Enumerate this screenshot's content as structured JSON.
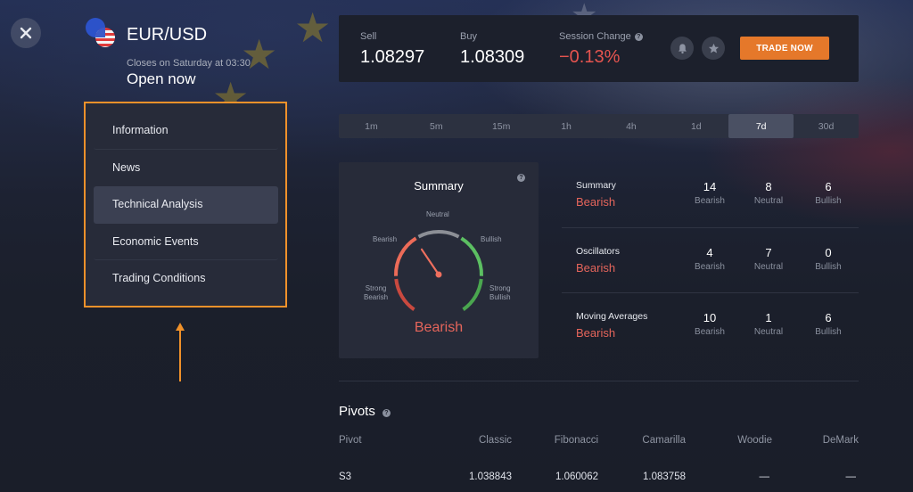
{
  "asset": {
    "name": "EUR/USD",
    "closes_text": "Closes on Saturday at 03:30",
    "status": "Open now"
  },
  "sidebar": {
    "items": [
      {
        "label": "Information",
        "active": false
      },
      {
        "label": "News",
        "active": false
      },
      {
        "label": "Technical Analysis",
        "active": true
      },
      {
        "label": "Economic Events",
        "active": false
      },
      {
        "label": "Trading Conditions",
        "active": false
      }
    ],
    "highlight_color": "#f0912a"
  },
  "quote": {
    "sell_label": "Sell",
    "sell_value": "1.08297",
    "buy_label": "Buy",
    "buy_value": "1.08309",
    "change_label": "Session Change",
    "change_value": "−0.13%",
    "trade_button": "TRADE NOW",
    "icons": [
      "bell-icon",
      "star-icon"
    ]
  },
  "timeframes": {
    "items": [
      "1m",
      "5m",
      "15m",
      "1h",
      "4h",
      "1d",
      "7d",
      "30d"
    ],
    "selected": "7d"
  },
  "gauge": {
    "title": "Summary",
    "labels": {
      "strong_bearish": "Strong\nBearish",
      "bearish": "Bearish",
      "neutral": "Neutral",
      "bullish": "Bullish",
      "strong_bullish": "Strong\nBullish"
    },
    "result": "Bearish",
    "needle_position": "bearish"
  },
  "indicators": {
    "rows": [
      {
        "name": "Summary",
        "verdict": "Bearish",
        "bearish": "14",
        "neutral": "8",
        "bullish": "6"
      },
      {
        "name": "Oscillators",
        "verdict": "Bearish",
        "bearish": "4",
        "neutral": "7",
        "bullish": "0"
      },
      {
        "name": "Moving Averages",
        "verdict": "Bearish",
        "bearish": "10",
        "neutral": "1",
        "bullish": "6"
      }
    ],
    "captions": {
      "bearish": "Bearish",
      "neutral": "Neutral",
      "bullish": "Bullish"
    }
  },
  "pivots": {
    "title": "Pivots",
    "columns": [
      "Pivot",
      "Classic",
      "Fibonacci",
      "Camarilla",
      "Woodie",
      "DeMark"
    ],
    "rows": [
      [
        "S3",
        "1.038843",
        "1.060062",
        "1.083758",
        "—",
        "—"
      ]
    ]
  },
  "colors": {
    "accent": "#e5782a",
    "bearish": "#e5655b",
    "bullish": "#5cb85c",
    "neutral": "#8c8f96"
  }
}
